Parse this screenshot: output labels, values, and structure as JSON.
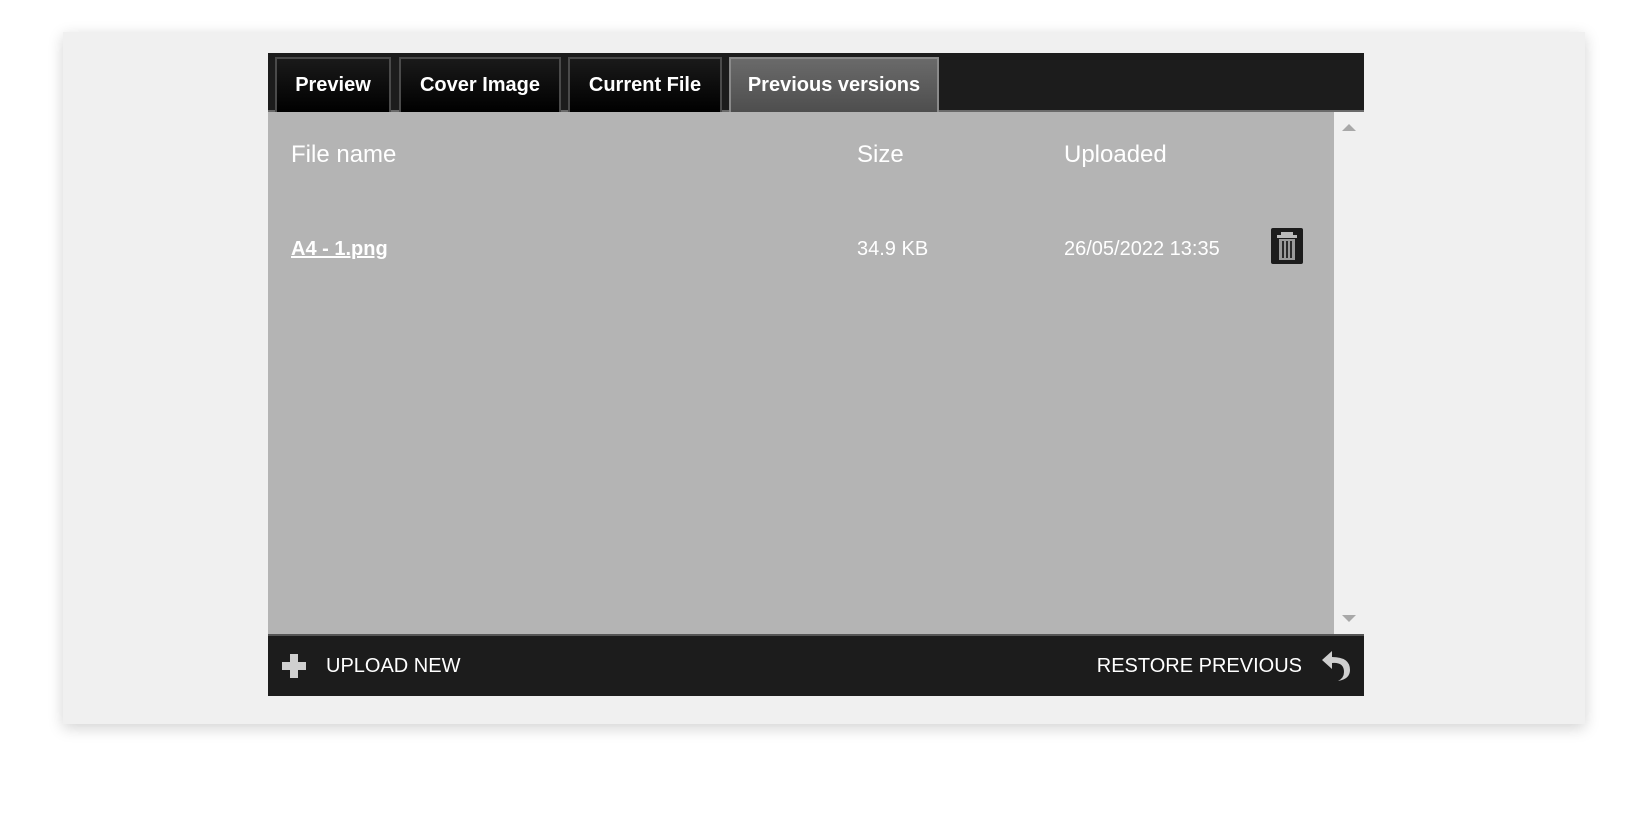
{
  "tabs": [
    {
      "label": "Preview",
      "active": false
    },
    {
      "label": "Cover Image",
      "active": false
    },
    {
      "label": "Current File",
      "active": false
    },
    {
      "label": "Previous versions",
      "active": true
    }
  ],
  "table": {
    "columns": [
      "File name",
      "Size",
      "Uploaded"
    ],
    "rows": [
      {
        "file_name": "A4 - 1.png",
        "size": "34.9 KB",
        "uploaded": "26/05/2022 13:35",
        "action_icon": "trash-icon"
      }
    ]
  },
  "footer": {
    "upload_label": "UPLOAD NEW",
    "upload_icon": "plus-icon",
    "restore_label": "RESTORE PREVIOUS",
    "restore_icon": "undo-arrow-icon"
  },
  "colors": {
    "bar": "#1c1c1c",
    "content": "#b4b4b4",
    "active_tab": "#5c5c5c",
    "page": "#f0f0f0"
  }
}
